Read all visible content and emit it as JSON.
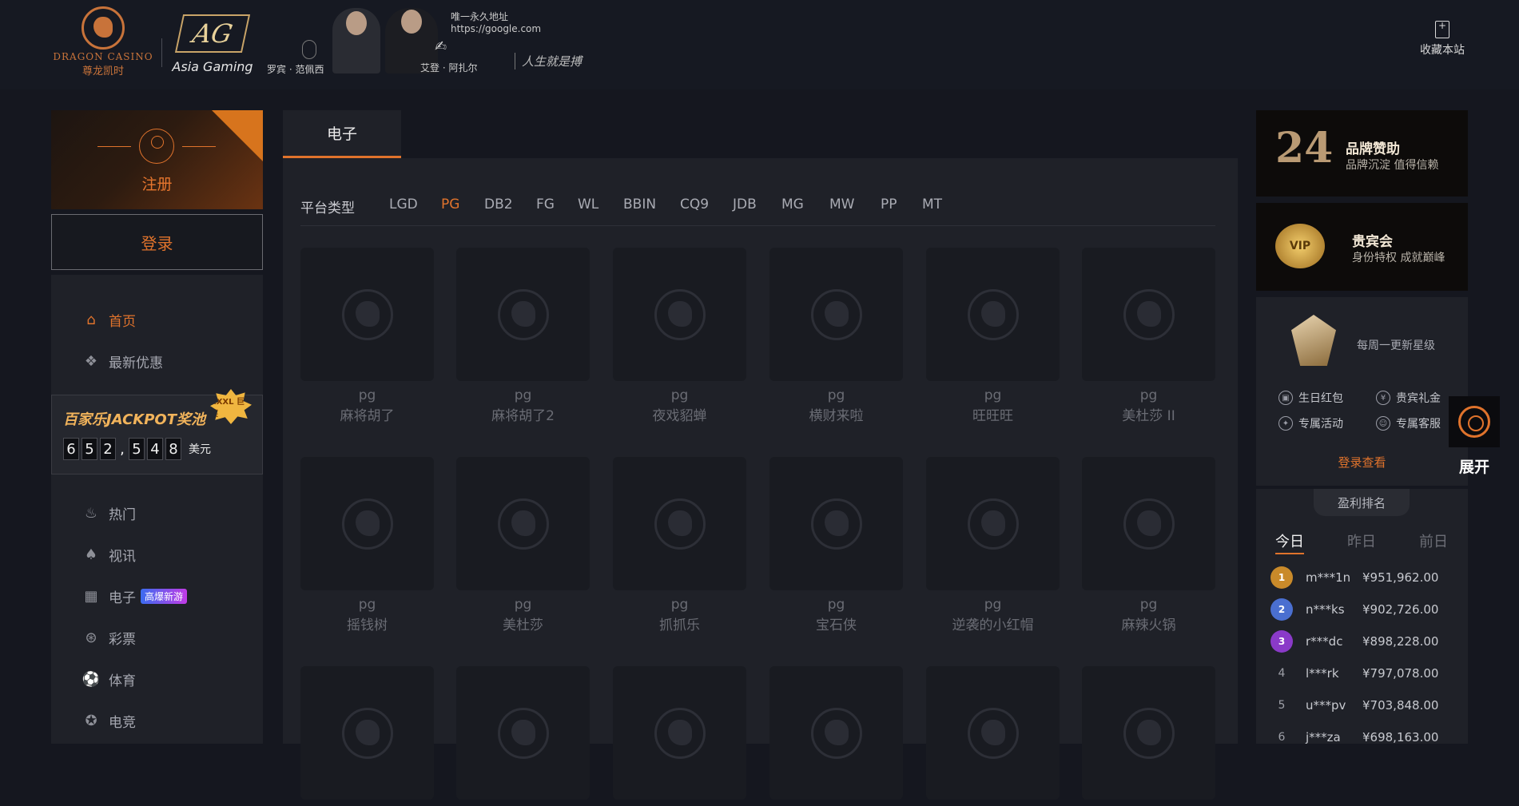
{
  "header": {
    "brand_en": "DRAGON CASINO",
    "brand_cn": "尊龙凯时",
    "partner_logo": "AG",
    "partner_name": "Asia Gaming",
    "ambassador1": "罗宾 · 范佩西",
    "ambassador2": "艾登 · 阿扎尔",
    "url_label": "唯一永久地址",
    "url": "https://google.com",
    "slogan": "人生就是搏",
    "bookmark_label": "收藏本站"
  },
  "sidebar": {
    "register_label": "注册",
    "login_label": "登录",
    "nav_top": [
      {
        "label": "首页",
        "icon": "home-icon",
        "glyph": "⌂"
      },
      {
        "label": "最新优惠",
        "icon": "gift-icon",
        "glyph": "❖"
      }
    ],
    "jackpot": {
      "title": "百家乐JACKPOT奖池",
      "badge": "XXXL 巨奖",
      "digits": [
        "6",
        "5",
        "2",
        ",",
        "5",
        "4",
        "8"
      ],
      "unit": "美元"
    },
    "nav_bottom": [
      {
        "label": "热门",
        "icon": "fire-icon",
        "glyph": "♨"
      },
      {
        "label": "视讯",
        "icon": "cards-icon",
        "glyph": "♠"
      },
      {
        "label": "电子",
        "icon": "slot-icon",
        "glyph": "▦",
        "badge": "高爆新游"
      },
      {
        "label": "彩票",
        "icon": "lottery-icon",
        "glyph": "⊛"
      },
      {
        "label": "体育",
        "icon": "sports-icon",
        "glyph": "⚽"
      },
      {
        "label": "电竞",
        "icon": "gamepad-icon",
        "glyph": "✪"
      }
    ]
  },
  "main": {
    "tab": "电子",
    "platform_label": "平台类型",
    "platforms": [
      "LGD",
      "PG",
      "DB2",
      "FG",
      "WL",
      "BBIN",
      "CQ9",
      "JDB",
      "MG",
      "MW",
      "PP",
      "MT"
    ],
    "active_platform": "PG",
    "games": [
      {
        "provider": "pg",
        "name": "麻将胡了"
      },
      {
        "provider": "pg",
        "name": "麻将胡了2"
      },
      {
        "provider": "pg",
        "name": "夜戏貂蝉"
      },
      {
        "provider": "pg",
        "name": "横财来啦"
      },
      {
        "provider": "pg",
        "name": "旺旺旺"
      },
      {
        "provider": "pg",
        "name": "美杜莎 II"
      },
      {
        "provider": "pg",
        "name": "摇钱树"
      },
      {
        "provider": "pg",
        "name": "美杜莎"
      },
      {
        "provider": "pg",
        "name": "抓抓乐"
      },
      {
        "provider": "pg",
        "name": "宝石侠"
      },
      {
        "provider": "pg",
        "name": "逆袭的小红帽"
      },
      {
        "provider": "pg",
        "name": "麻辣火锅"
      },
      {
        "provider": "",
        "name": ""
      },
      {
        "provider": "",
        "name": ""
      },
      {
        "provider": "",
        "name": ""
      },
      {
        "provider": "",
        "name": ""
      },
      {
        "provider": "",
        "name": ""
      },
      {
        "provider": "",
        "name": ""
      }
    ]
  },
  "right": {
    "promo1": {
      "number": "24",
      "title": "品牌赞助",
      "sub": "品牌沉淀 值得信赖"
    },
    "promo2": {
      "badge": "VIP",
      "title": "贵宾会",
      "sub": "身份特权 成就巅峰"
    },
    "tier_note": "每周一更新星级",
    "perks": [
      {
        "label": "生日红包",
        "icon": "gift-box-icon"
      },
      {
        "label": "贵宾礼金",
        "icon": "money-icon"
      },
      {
        "label": "专属活动",
        "icon": "event-icon"
      },
      {
        "label": "专属客服",
        "icon": "support-icon"
      }
    ],
    "login_view": "登录查看",
    "ranking_title": "盈利排名",
    "day_tabs": [
      "今日",
      "昨日",
      "前日"
    ],
    "ranking": [
      {
        "rank": "1",
        "user": "m***1n",
        "amount": "¥951,962.00"
      },
      {
        "rank": "2",
        "user": "n***ks",
        "amount": "¥902,726.00"
      },
      {
        "rank": "3",
        "user": "r***dc",
        "amount": "¥898,228.00"
      },
      {
        "rank": "4",
        "user": "l***rk",
        "amount": "¥797,078.00"
      },
      {
        "rank": "5",
        "user": "u***pv",
        "amount": "¥703,848.00"
      },
      {
        "rank": "6",
        "user": "j***za",
        "amount": "¥698,163.00"
      }
    ]
  },
  "float_service": {
    "label": "展开"
  },
  "colors": {
    "accent": "#e0732c",
    "bg": "#15171f",
    "panel": "#1f2128"
  }
}
